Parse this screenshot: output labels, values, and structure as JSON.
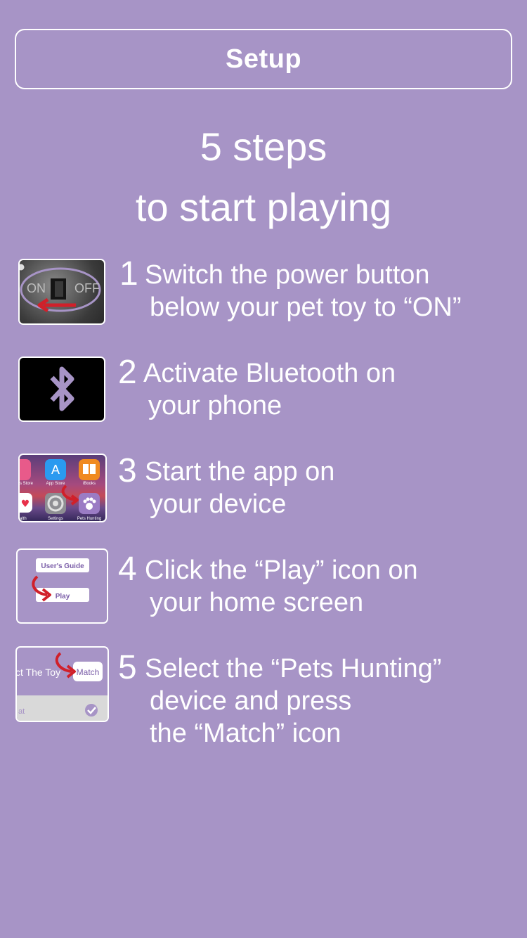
{
  "colors": {
    "background": "#a794c6",
    "accent_arrow": "#d0202a",
    "border": "#ffffff"
  },
  "header": {
    "button_label": "Setup"
  },
  "headline": {
    "line1": "5 steps",
    "line2": "to start playing"
  },
  "steps": [
    {
      "number": "1",
      "line1": "Switch the power button",
      "line2": "below your pet toy to “ON”",
      "thumb": {
        "on_label": "ON",
        "off_label": "OFF",
        "icon": "power-switch-icon"
      }
    },
    {
      "number": "2",
      "line1": "Activate Bluetooth on",
      "line2": "your phone",
      "thumb": {
        "icon": "bluetooth-icon"
      }
    },
    {
      "number": "3",
      "line1": "Start the app on",
      "line2": "your device",
      "thumb": {
        "apps": [
          "s Store",
          "App Store",
          "iBooks",
          "alth",
          "Settings",
          "Pets Hunting"
        ]
      }
    },
    {
      "number": "4",
      "line1": "Click the “Play” icon on",
      "line2": "your home screen",
      "thumb": {
        "guide_label": "User's Guide",
        "play_label": "Play"
      }
    },
    {
      "number": "5",
      "line1": "Select the “Pets Hunting”",
      "line2": "device and press",
      "line3": "the “Match” icon",
      "thumb": {
        "toy_label": "ct The Toy",
        "match_label": "Match",
        "row_label": "at"
      }
    }
  ]
}
